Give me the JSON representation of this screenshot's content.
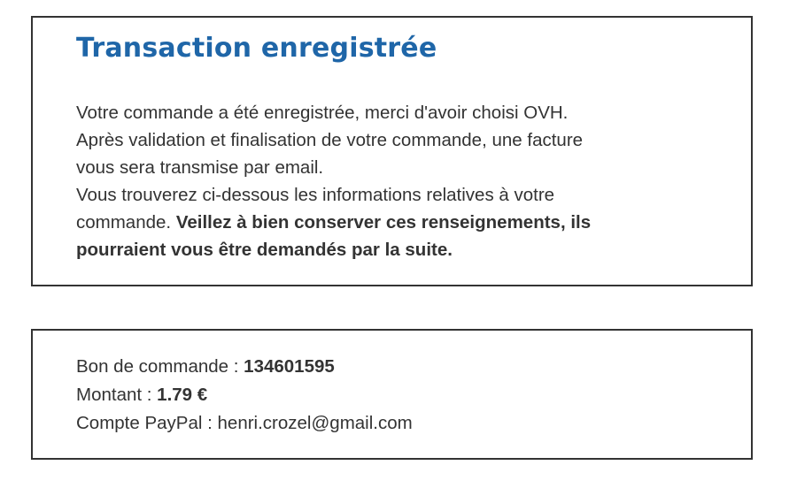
{
  "confirmation": {
    "title": "Transaction enregistrée",
    "lines": [
      "Votre commande a été enregistrée, merci d'avoir choisi OVH.",
      "Après validation et finalisation de votre commande, une facture",
      "vous sera transmise par email.",
      "Vous trouverez ci-dessous les informations relatives à votre",
      "commande. "
    ],
    "emphasis_line1": "Veillez à bien conserver ces renseignements, ils",
    "emphasis_line2": "pourraient vous être demandés par la suite."
  },
  "order_details": {
    "order_label": "Bon de commande : ",
    "order_value": "134601595",
    "amount_label": "Montant : ",
    "amount_value": "1.79 €",
    "paypal_label": "Compte PayPal : ",
    "paypal_value": "henri.crozel@gmail.com"
  },
  "colors": {
    "title": "#1f66a8",
    "text": "#333333",
    "border": "#333333"
  }
}
